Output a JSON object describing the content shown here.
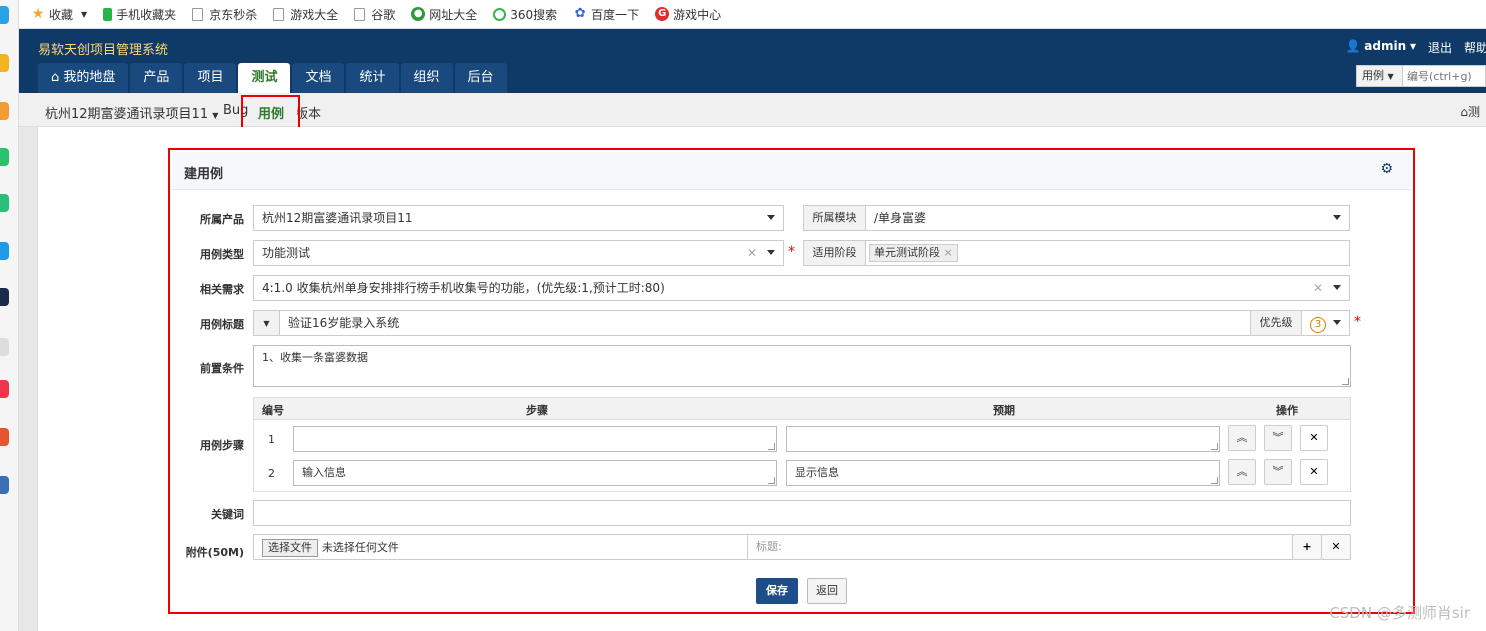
{
  "bookmarks": [
    "收藏",
    "手机收藏夹",
    "京东秒杀",
    "游戏大全",
    "谷歌",
    "网址大全",
    "360搜索",
    "百度一下",
    "游戏中心"
  ],
  "header": {
    "app_title": "易软天创项目管理系统",
    "user": "admin",
    "logout": "退出",
    "help": "帮助",
    "nav": [
      "我的地盘",
      "产品",
      "项目",
      "测试",
      "文档",
      "统计",
      "组织",
      "后台"
    ],
    "search_type": "用例",
    "search_placeholder": "编号(ctrl+g)"
  },
  "subnav": {
    "product": "杭州12期富婆通讯录项目11",
    "bug": "Bug",
    "case": "用例",
    "version": "版本"
  },
  "form": {
    "title": "建用例",
    "labels": {
      "product": "所属产品",
      "module": "所属模块",
      "type": "用例类型",
      "stage": "适用阶段",
      "story": "相关需求",
      "case_title": "用例标题",
      "priority": "优先级",
      "precondition": "前置条件",
      "steps": "用例步骤",
      "keywords": "关键词",
      "attachment": "附件(50M)"
    },
    "product_value": "杭州12期富婆通讯录项目11",
    "module_value": "/单身富婆",
    "type_value": "功能测试",
    "stage_chip": "单元测试阶段",
    "story_value": "4:1.0 收集杭州单身安排排行榜手机收集号的功能，(优先级:1,预计工时:80)",
    "title_value": "验证16岁能录入系统",
    "priority_value": "3",
    "precondition_value": "1、收集一条富婆数据",
    "steps_header": {
      "no": "编号",
      "step": "步骤",
      "expect": "预期",
      "ops": "操作"
    },
    "steps": [
      {
        "no": "1",
        "step": "",
        "expect": ""
      },
      {
        "no": "2",
        "step": "输入信息",
        "expect": "显示信息"
      }
    ],
    "keywords_value": "",
    "file_button": "选择文件",
    "file_status": "未选择任何文件",
    "file_title_placeholder": "标题:",
    "save": "保存",
    "back": "返回"
  },
  "watermark": "CSDN @多测师肖sir",
  "colors": {
    "header_bg": "#0f3967",
    "title_yellow": "#ffd777",
    "active_green": "#2e7a2e",
    "save_blue": "#1d4e89",
    "highlight_red": "#e00000"
  }
}
